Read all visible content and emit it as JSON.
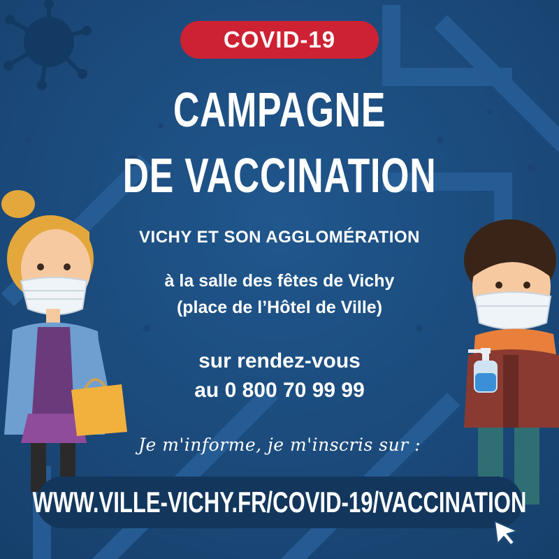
{
  "badge": {
    "label": "COVID-19",
    "color": "#cd2233"
  },
  "title": {
    "line1": "CAMPAGNE",
    "line2": "DE VACCINATION"
  },
  "subtitle": "VICHY ET SON AGGLOMÉRATION",
  "location": {
    "line1": "à la salle des fêtes de Vichy",
    "line2": "(place de l’Hôtel de Ville)"
  },
  "appointment": {
    "line1": "sur rendez-vous",
    "line2": "au 0 800 70 99 99"
  },
  "info_text": "Je m'informe, je m'inscris sur :",
  "url": "WWW.VILLE-VICHY.FR/COVID-19/VACCINATION",
  "colors": {
    "background": "#1c4a7a",
    "accent": "#cd2233",
    "text": "#ffffff"
  },
  "icons": [
    "virus-icon",
    "pointer-cursor-icon",
    "shopping-bag-icon",
    "hand-sanitizer-icon"
  ]
}
